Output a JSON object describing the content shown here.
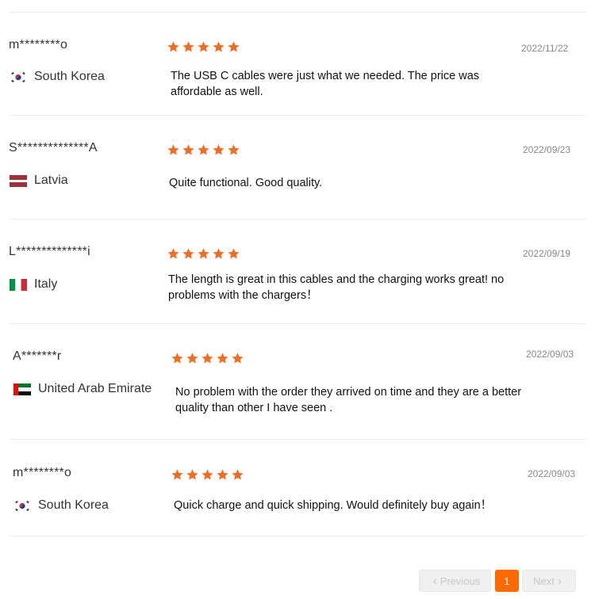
{
  "reviews": [
    {
      "name": "m********o",
      "country": "South Korea",
      "flag": "kr",
      "rating": 5,
      "date": "2022/11/22",
      "text": "The USB C cables were just what we needed. The price was affordable as well."
    },
    {
      "name": "S**************A",
      "country": "Latvia",
      "flag": "lv",
      "rating": 5,
      "date": "2022/09/23",
      "text": "Quite functional. Good quality."
    },
    {
      "name": "L**************i",
      "country": "Italy",
      "flag": "it",
      "rating": 5,
      "date": "2022/09/19",
      "text": "The length is great in this cables and the charging works great! no problems with the chargers！"
    },
    {
      "name": "A*******r",
      "country": "United Arab Emirate",
      "flag": "ae",
      "rating": 5,
      "date": "2022/09/03",
      "text": "No problem with the order they arrived on time and they are a better quality than other I have seen ."
    },
    {
      "name": "m********o",
      "country": "South Korea",
      "flag": "kr",
      "rating": 5,
      "date": "2022/09/03",
      "text": "Quick charge and quick shipping. Would definitely buy again！"
    }
  ],
  "pagination": {
    "previous_label": "Previous",
    "current_page": "1",
    "next_label": "Next",
    "previous_icon": "chevron-left-icon",
    "next_icon": "chevron-right-icon"
  },
  "colors": {
    "star": "#f26c22",
    "accent": "#ff6a00"
  }
}
